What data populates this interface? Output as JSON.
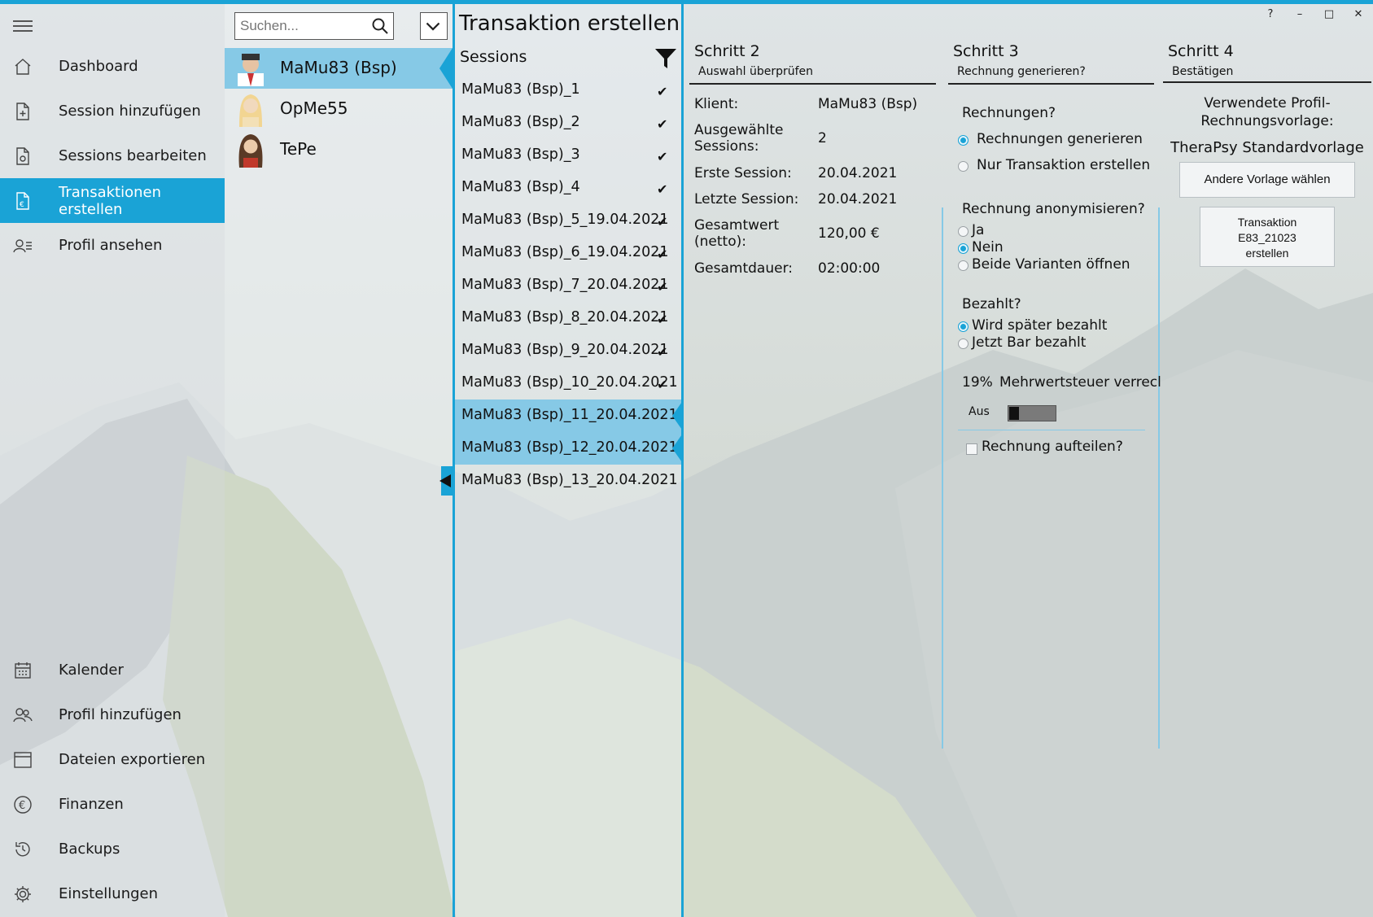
{
  "window": {
    "controls": {
      "help": "?",
      "minimize": "–",
      "maximize": "□",
      "close": "✕"
    }
  },
  "page_title": "Transaktion erstellen",
  "nav": {
    "items": [
      {
        "label": "Dashboard",
        "icon": "home-icon",
        "active": false
      },
      {
        "label": "Session hinzufügen",
        "icon": "add-document-icon",
        "active": false
      },
      {
        "label": "Sessions bearbeiten",
        "icon": "edit-document-icon",
        "active": false
      },
      {
        "label": "Transaktionen erstellen",
        "icon": "euro-document-icon",
        "active": true
      },
      {
        "label": "Profil ansehen",
        "icon": "profile-icon",
        "active": false
      }
    ],
    "bottom_items": [
      {
        "label": "Kalender",
        "icon": "calendar-icon"
      },
      {
        "label": "Profil hinzufügen",
        "icon": "add-profile-icon"
      },
      {
        "label": "Dateien exportieren",
        "icon": "export-icon"
      },
      {
        "label": "Finanzen",
        "icon": "euro-icon"
      },
      {
        "label": "Backups",
        "icon": "history-icon"
      },
      {
        "label": "Einstellungen",
        "icon": "gear-icon"
      }
    ]
  },
  "search": {
    "placeholder": "Suchen..."
  },
  "profiles": [
    {
      "name": "MaMu83 (Bsp)",
      "selected": true
    },
    {
      "name": "OpMe55",
      "selected": false
    },
    {
      "name": "TePe",
      "selected": false
    }
  ],
  "sessions": {
    "header": "Sessions",
    "items": [
      {
        "label": "MaMu83 (Bsp)_1",
        "checked": true,
        "selected": false
      },
      {
        "label": "MaMu83 (Bsp)_2",
        "checked": true,
        "selected": false
      },
      {
        "label": "MaMu83 (Bsp)_3",
        "checked": true,
        "selected": false
      },
      {
        "label": "MaMu83 (Bsp)_4",
        "checked": true,
        "selected": false
      },
      {
        "label": "MaMu83 (Bsp)_5_19.04.2021",
        "checked": true,
        "selected": false
      },
      {
        "label": "MaMu83 (Bsp)_6_19.04.2021",
        "checked": true,
        "selected": false
      },
      {
        "label": "MaMu83 (Bsp)_7_20.04.2021",
        "checked": true,
        "selected": false
      },
      {
        "label": "MaMu83 (Bsp)_8_20.04.2021",
        "checked": true,
        "selected": false
      },
      {
        "label": "MaMu83 (Bsp)_9_20.04.2021",
        "checked": true,
        "selected": false
      },
      {
        "label": "MaMu83 (Bsp)_10_20.04.2021",
        "checked": true,
        "selected": false
      },
      {
        "label": "MaMu83 (Bsp)_11_20.04.2021",
        "checked": false,
        "selected": true
      },
      {
        "label": "MaMu83 (Bsp)_12_20.04.2021",
        "checked": false,
        "selected": true
      },
      {
        "label": "MaMu83 (Bsp)_13_20.04.2021",
        "checked": false,
        "selected": false
      }
    ]
  },
  "step2": {
    "title": "Schritt 2",
    "subtitle": "Auswahl überprüfen",
    "rows": [
      {
        "key": "Klient:",
        "value": "MaMu83 (Bsp)"
      },
      {
        "key": "Ausgewählte\nSessions:",
        "value": "2"
      },
      {
        "key": "Erste Session:",
        "value": "20.04.2021"
      },
      {
        "key": "Letzte Session:",
        "value": "20.04.2021"
      },
      {
        "key": "Gesamtwert\n(netto):",
        "value": "120,00 €"
      },
      {
        "key": "Gesamtdauer:",
        "value": "02:00:00"
      }
    ]
  },
  "step3": {
    "title": "Schritt 3",
    "subtitle": "Rechnung generieren?",
    "invoices_q": "Rechnungen?",
    "invoices_opts": [
      "Rechnungen generieren",
      "Nur Transaktion erstellen"
    ],
    "anon_q": "Rechnung anonymisieren?",
    "anon_opts": [
      "Ja",
      "Nein",
      "Beide Varianten öffnen"
    ],
    "paid_q": "Bezahlt?",
    "paid_opts": [
      "Wird später bezahlt",
      "Jetzt Bar bezahlt"
    ],
    "vat_pct": "19%",
    "vat_label": "Mehrwertsteuer verrecl",
    "vat_toggle": "Aus",
    "split_label": "Rechnung aufteilen?"
  },
  "step4": {
    "title": "Schritt 4",
    "subtitle": "Bestätigen",
    "template_label_1": "Verwendete Profil-",
    "template_label_2": "Rechnungsvorlage:",
    "template_name": "TheraPsy Standardvorlage",
    "change_button": "Andere Vorlage wählen",
    "create_button_1": "Transaktion",
    "create_button_2": "E83_21023",
    "create_button_3": "erstellen"
  },
  "colors": {
    "accent": "#1aa3d6",
    "selection": "#86c9e6"
  }
}
